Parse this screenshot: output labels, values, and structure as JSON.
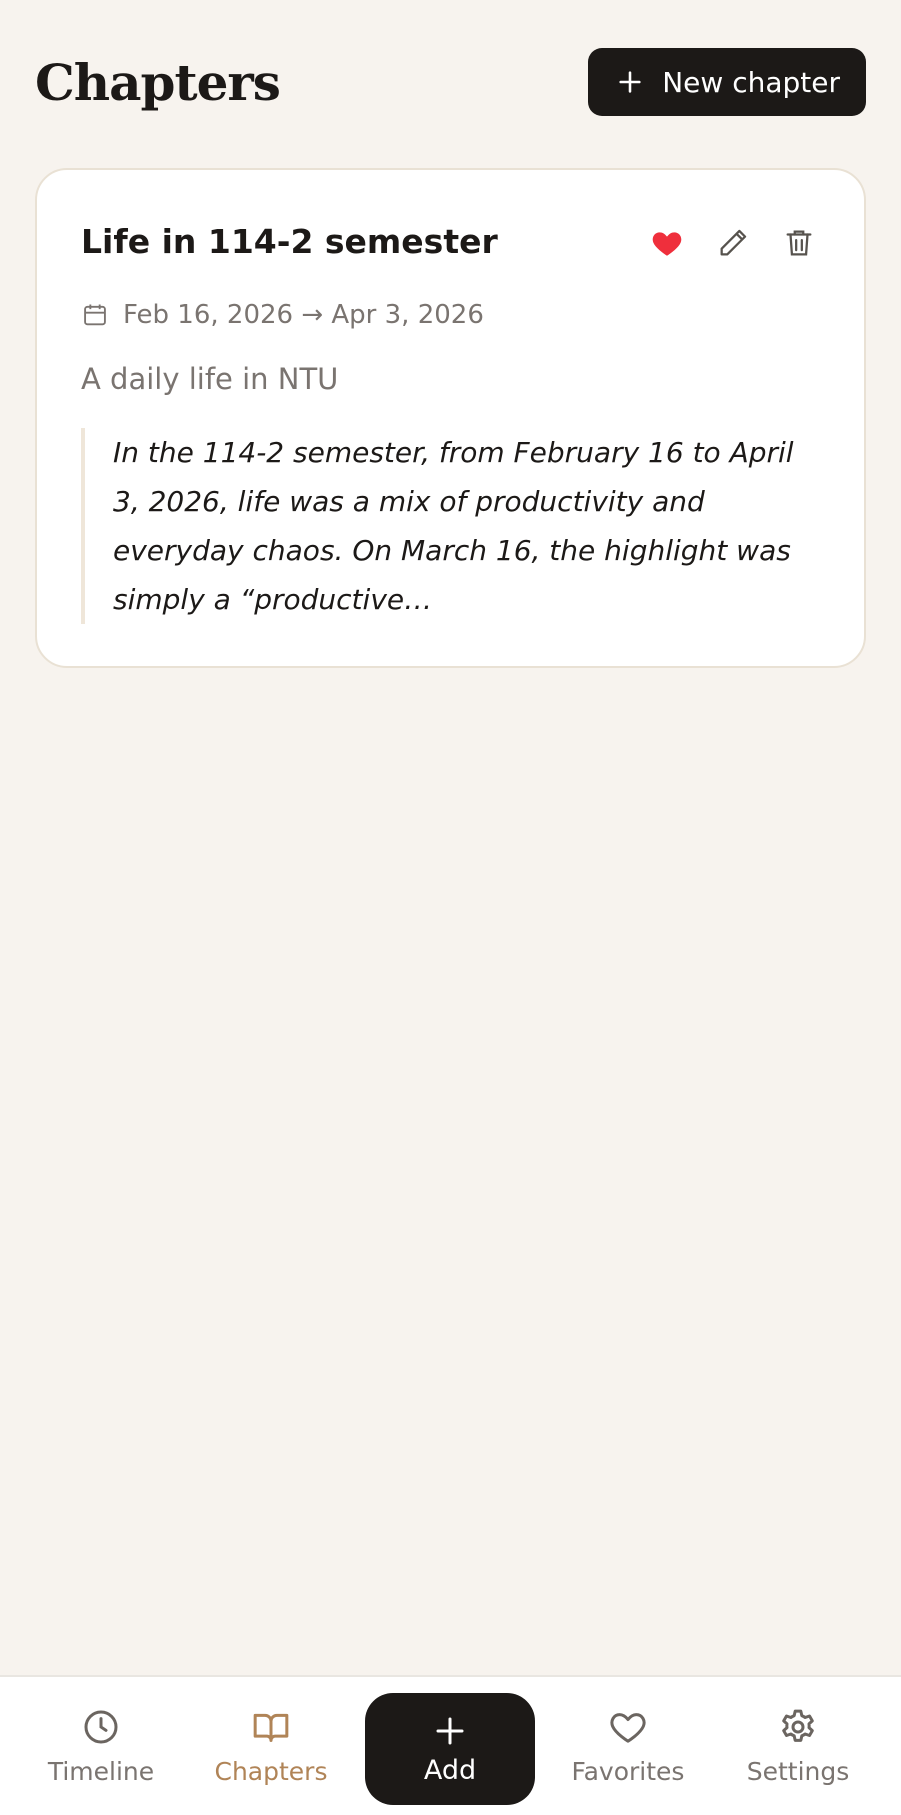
{
  "header": {
    "title": "Chapters",
    "new_button_label": "New chapter"
  },
  "chapters": [
    {
      "title": "Life in 114-2 semester",
      "date_range": "Feb 16, 2026 → Apr 3, 2026",
      "subtitle": "A daily life in NTU",
      "excerpt": "In the 114-2 semester, from February 16 to April 3, 2026, life was a mix of productivity and everyday chaos. On March 16, the highlight was simply a “productive…",
      "favorited": true
    }
  ],
  "nav": {
    "items": [
      {
        "label": "Timeline",
        "icon": "clock-icon"
      },
      {
        "label": "Chapters",
        "icon": "book-icon",
        "active": true
      },
      {
        "label": "Add",
        "icon": "plus-icon"
      },
      {
        "label": "Favorites",
        "icon": "heart-icon"
      },
      {
        "label": "Settings",
        "icon": "gear-icon"
      }
    ]
  },
  "colors": {
    "background": "#f7f3ee",
    "accent": "#b08457",
    "favorite": "#ef2f3c",
    "dark": "#1c1917"
  }
}
